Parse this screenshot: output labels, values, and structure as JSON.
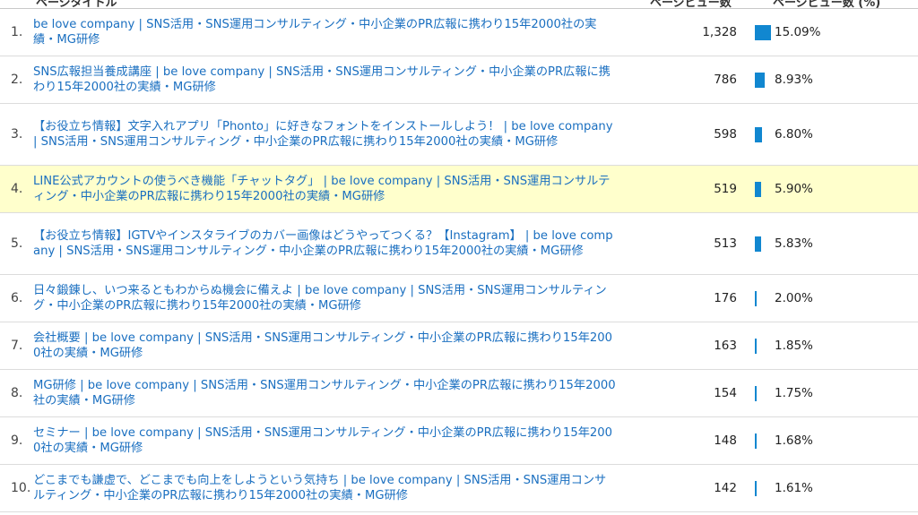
{
  "header": {
    "title_col": "ページタイトル",
    "views_col": "ページビュー数",
    "pct_col": "ページビュー数 (%)"
  },
  "colors": {
    "link": "#1a6fc0",
    "bar": "#1187d0",
    "highlight_row": "#ffffcc"
  },
  "rows": [
    {
      "rank": "1.",
      "title": "be love company | SNS活用・SNS運用コンサルティング・中小企業のPR広報に携わり15年2000社の実績・MG研修",
      "views": "1,328",
      "pct": "15.09%",
      "share": 15.09
    },
    {
      "rank": "2.",
      "title": "SNS広報担当養成講座 | be love company | SNS活用・SNS運用コンサルティング・中小企業のPR広報に携わり15年2000社の実績・MG研修",
      "views": "786",
      "pct": "8.93%",
      "share": 8.93
    },
    {
      "rank": "3.",
      "title": "【お役立ち情報】文字入れアプリ「Phonto」に好きなフォントをインストールしよう！ | be love company | SNS活用・SNS運用コンサルティング・中小企業のPR広報に携わり15年2000社の実績・MG研修",
      "views": "598",
      "pct": "6.80%",
      "share": 6.8
    },
    {
      "rank": "4.",
      "title": "LINE公式アカウントの使うべき機能「チャットタグ」 | be love company | SNS活用・SNS運用コンサルティング・中小企業のPR広報に携わり15年2000社の実績・MG研修",
      "views": "519",
      "pct": "5.90%",
      "share": 5.9
    },
    {
      "rank": "5.",
      "title": "【お役立ち情報】IGTVやインスタライブのカバー画像はどうやってつくる？【Instagram】 | be love company | SNS活用・SNS運用コンサルティング・中小企業のPR広報に携わり15年2000社の実績・MG研修",
      "views": "513",
      "pct": "5.83%",
      "share": 5.83
    },
    {
      "rank": "6.",
      "title": "日々鍛錬し、いつ来るともわからぬ機会に備えよ | be love company | SNS活用・SNS運用コンサルティング・中小企業のPR広報に携わり15年2000社の実績・MG研修",
      "views": "176",
      "pct": "2.00%",
      "share": 2.0
    },
    {
      "rank": "7.",
      "title": "会社概要 | be love company | SNS活用・SNS運用コンサルティング・中小企業のPR広報に携わり15年2000社の実績・MG研修",
      "views": "163",
      "pct": "1.85%",
      "share": 1.85
    },
    {
      "rank": "8.",
      "title": "MG研修 | be love company | SNS活用・SNS運用コンサルティング・中小企業のPR広報に携わり15年2000社の実績・MG研修",
      "views": "154",
      "pct": "1.75%",
      "share": 1.75
    },
    {
      "rank": "9.",
      "title": "セミナー | be love company | SNS活用・SNS運用コンサルティング・中小企業のPR広報に携わり15年2000社の実績・MG研修",
      "views": "148",
      "pct": "1.68%",
      "share": 1.68
    },
    {
      "rank": "10.",
      "title": "どこまでも謙虚で、どこまでも向上をしようという気持ち | be love company | SNS活用・SNS運用コンサルティング・中小企業のPR広報に携わり15年2000社の実績・MG研修",
      "views": "142",
      "pct": "1.61%",
      "share": 1.61
    }
  ]
}
